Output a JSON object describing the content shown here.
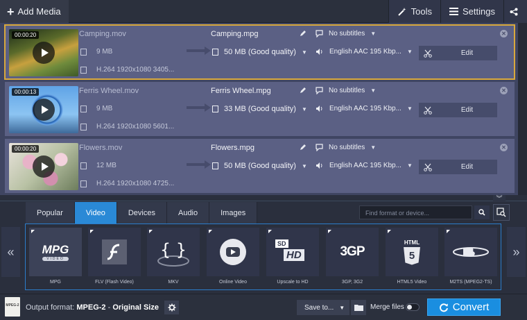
{
  "toolbar": {
    "add_media_label": "Add Media",
    "tools_label": "Tools",
    "settings_label": "Settings"
  },
  "files": [
    {
      "duration": "00:00:20",
      "source_name": "Camping.mov",
      "source_size": "9 MB",
      "source_codec": "H.264 1920x1080 3405...",
      "output_name": "Camping.mpg",
      "output_size": "50 MB (Good quality)",
      "subtitles": "No subtitles",
      "audio": "English AAC 195 Kbp...",
      "edit_label": "Edit",
      "selected": true
    },
    {
      "duration": "00:00:13",
      "source_name": "Ferris Wheel.mov",
      "source_size": "9 MB",
      "source_codec": "H.264 1920x1080 5601...",
      "output_name": "Ferris Wheel.mpg",
      "output_size": "33 MB (Good quality)",
      "subtitles": "No subtitles",
      "audio": "English AAC 195 Kbp...",
      "edit_label": "Edit",
      "selected": false
    },
    {
      "duration": "00:00:20",
      "source_name": "Flowers.mov",
      "source_size": "12 MB",
      "source_codec": "H.264 1920x1080 4725...",
      "output_name": "Flowers.mpg",
      "output_size": "50 MB (Good quality)",
      "subtitles": "No subtitles",
      "audio": "English AAC 195 Kbp...",
      "edit_label": "Edit",
      "selected": false
    }
  ],
  "format_tabs": [
    "Popular",
    "Video",
    "Devices",
    "Audio",
    "Images"
  ],
  "active_tab": "Video",
  "search": {
    "placeholder": "Find format or device..."
  },
  "formats": [
    {
      "label": "MPG",
      "icon": "mpg-icon"
    },
    {
      "label": "FLV (Flash Video)",
      "icon": "flash-icon"
    },
    {
      "label": "MKV",
      "icon": "mkv-icon"
    },
    {
      "label": "Online Video",
      "icon": "youtube-play-icon"
    },
    {
      "label": "Upscale to HD",
      "icon": "sd-hd-icon"
    },
    {
      "label": "3GP, 3G2",
      "icon": "3gp-icon"
    },
    {
      "label": "HTML5 Video",
      "icon": "html5-icon"
    },
    {
      "label": "M2TS (MPEG2-TS)",
      "icon": "bluray-icon"
    }
  ],
  "tile_text": {
    "mpg": "MPG",
    "mpg_sub": "VIDEO",
    "sd": "SD",
    "hd": "HD",
    "three_gp": "3GP",
    "html": "HTML",
    "five": "5"
  },
  "bottom": {
    "output_icon_text": "MPEG-2",
    "output_format_label": "Output format:",
    "output_format_value": "MPEG-2",
    "output_format_sep": " - ",
    "output_format_size": "Original Size",
    "save_to_label": "Save to...",
    "merge_label": "Merge files",
    "convert_label": "Convert"
  },
  "colors": {
    "accent": "#2a89d6",
    "selected_outline": "#d9a93c",
    "row_bg": "#5b6084",
    "convert": "#1a8ee0"
  }
}
